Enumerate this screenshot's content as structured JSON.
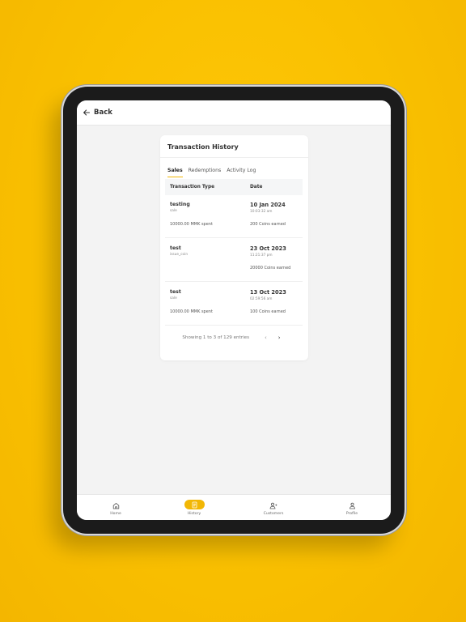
{
  "header": {
    "back_label": "Back"
  },
  "card": {
    "title": "Transaction History",
    "tabs": [
      {
        "label": "Sales",
        "active": true
      },
      {
        "label": "Redemptions",
        "active": false
      },
      {
        "label": "Activity Log",
        "active": false
      }
    ],
    "columns": {
      "type": "Transaction Type",
      "date": "Date"
    },
    "rows": [
      {
        "name": "testing",
        "type": "sale",
        "spent": "10000.00 MMK spent",
        "date": "10 Jan 2024",
        "time": "10:03:32 am",
        "coins": "200 Coins earned"
      },
      {
        "name": "test",
        "type": "issue_coin",
        "spent": "",
        "date": "23 Oct 2023",
        "time": "11:21:37 pm",
        "coins": "20000 Coins earned"
      },
      {
        "name": "test",
        "type": "sale",
        "spent": "10000.00 MMK spent",
        "date": "13 Oct 2023",
        "time": "02:59:56 am",
        "coins": "100 Coins earned"
      }
    ],
    "pagination": {
      "info": "Showing 1 to 3 of 129 entries",
      "prev": "‹",
      "next": "›"
    }
  },
  "nav": {
    "items": [
      {
        "label": "Home",
        "icon": "home-icon"
      },
      {
        "label": "History",
        "icon": "history-icon",
        "active": true
      },
      {
        "label": "Customers",
        "icon": "customers-icon"
      },
      {
        "label": "Profile",
        "icon": "profile-icon"
      }
    ]
  },
  "colors": {
    "background": "#f9c000",
    "accent": "#f2b705",
    "frame": "#1b1b1b"
  }
}
